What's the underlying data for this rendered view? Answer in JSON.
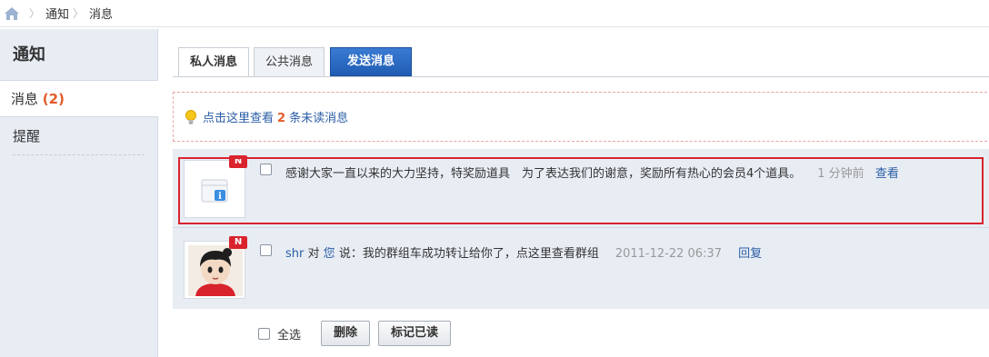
{
  "breadcrumb": {
    "home_icon": "home-icon",
    "items": [
      "通知",
      "消息"
    ]
  },
  "sidebar": {
    "title": "通知",
    "active_item": {
      "label": "消息",
      "count": "(2)"
    },
    "items": [
      {
        "label": "提醒"
      }
    ]
  },
  "tabs": {
    "items": [
      "私人消息",
      "公共消息"
    ],
    "send_label": "发送消息"
  },
  "notice": {
    "prefix": "点击这里查看",
    "count": "2",
    "suffix": "条未读消息"
  },
  "messages": [
    {
      "badge": "N",
      "avatar_icon": "system-notice-icon",
      "text": "感谢大家一直以来的大力坚持，特奖励道具　为了表达我们的谢意，奖励所有热心的会员4个道具。",
      "time": "1 分钟前",
      "action": "查看"
    },
    {
      "badge": "N",
      "avatar_icon": "user-avatar",
      "sender": "shr",
      "mid_text": "对",
      "target": "您",
      "text": "说：我的群组车成功转让给你了，点这里查看群组",
      "time": "2011-12-22 06:37",
      "action": "回复"
    }
  ],
  "bottom": {
    "select_all": "全选",
    "delete_label": "删除",
    "mark_read_label": "标记已读"
  },
  "colors": {
    "accent": "#e35b2a",
    "link": "#2b5ea6",
    "send_button": "#2563b8",
    "highlight_border": "#d9232d",
    "list_bg": "#e8edf4"
  }
}
